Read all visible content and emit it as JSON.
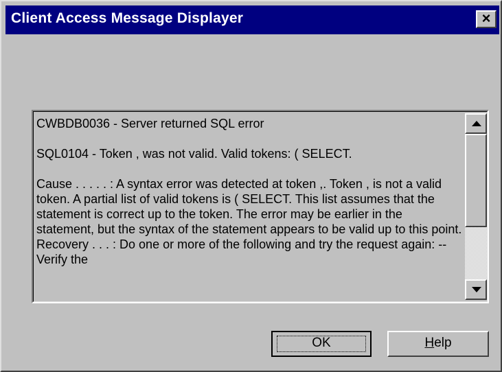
{
  "window": {
    "title": "Client Access Message Displayer",
    "close_glyph": "×"
  },
  "message": {
    "line1": "CWBDB0036 - Server returned SQL error",
    "line2": "SQL0104 - Token , was not valid. Valid tokens: ( SELECT.",
    "line3": "Cause . . . . . :   A syntax error was detected at token ,.  Token , is not a valid token.  A partial list of valid tokens is ( SELECT.  This list assumes that the statement is correct up to the token.  The error may be earlier in the statement, but the syntax of the statement appears to be valid up to this point. Recovery  . . . :   Do one or more of the following and try the request again: -- Verify the"
  },
  "buttons": {
    "ok_label": "OK",
    "help_mnemonic": "H",
    "help_rest": "elp"
  },
  "icons": {
    "close": "close-icon",
    "scroll_up": "arrow-up-icon",
    "scroll_down": "arrow-down-icon"
  },
  "colors": {
    "titlebar": "#000080",
    "window_face": "#c0c0c0"
  }
}
